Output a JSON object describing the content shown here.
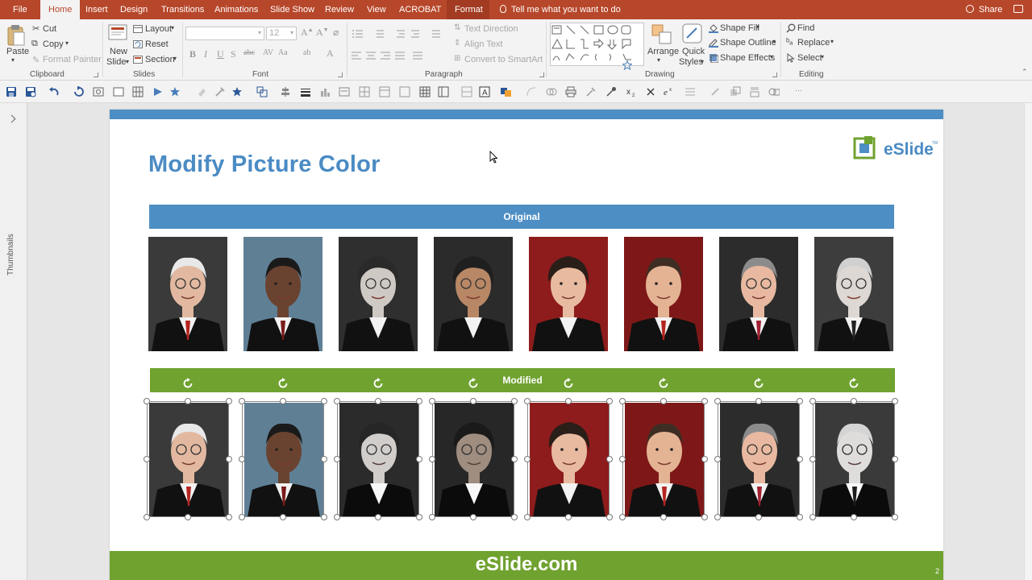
{
  "tabs": {
    "file": "File",
    "home": "Home",
    "insert": "Insert",
    "design": "Design",
    "transitions": "Transitions",
    "animations": "Animations",
    "slide_show": "Slide Show",
    "review": "Review",
    "view": "View",
    "acrobat": "ACROBAT",
    "format": "Format"
  },
  "tell_me": "Tell me what you want to do",
  "share": "Share",
  "ribbon": {
    "clipboard": {
      "label": "Clipboard",
      "paste": "Paste",
      "cut": "Cut",
      "copy": "Copy",
      "format_painter": "Format Painter"
    },
    "slides": {
      "label": "Slides",
      "new_slide_1": "New",
      "new_slide_2": "Slide",
      "layout": "Layout",
      "reset": "Reset",
      "section": "Section"
    },
    "font": {
      "label": "Font",
      "size": "12"
    },
    "paragraph": {
      "label": "Paragraph",
      "text_direction": "Text Direction",
      "align_text": "Align Text",
      "convert_smartart": "Convert to SmartArt"
    },
    "drawing": {
      "label": "Drawing",
      "arrange": "Arrange",
      "quick_styles_1": "Quick",
      "quick_styles_2": "Styles",
      "shape_fill": "Shape Fill",
      "shape_outline": "Shape Outline",
      "shape_effects": "Shape Effects"
    },
    "editing": {
      "label": "Editing",
      "find": "Find",
      "replace": "Replace",
      "select": "Select"
    }
  },
  "thumbnails_label": "Thumbnails",
  "slide": {
    "title": "Modify Picture Color",
    "logo_text": "eSlide",
    "logo_tm": "TM",
    "original_label": "Original",
    "modified_label": "Modified",
    "footer": "eSlide.com",
    "page_number": "2"
  },
  "colors": {
    "accent_red": "#b7472a",
    "slide_blue": "#4d8ec4",
    "slide_green": "#70a230"
  }
}
